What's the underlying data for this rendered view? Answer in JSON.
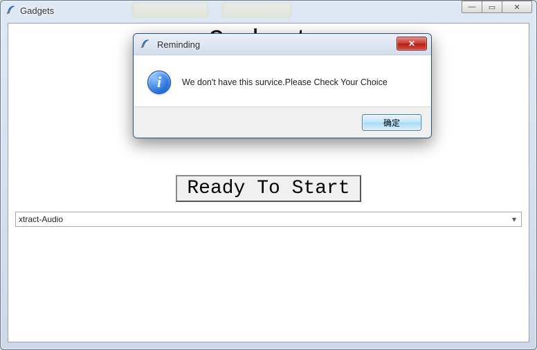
{
  "outer_window": {
    "title": "Gadgets"
  },
  "main": {
    "heading": "Gadgets",
    "start_button_label": "Ready To Start",
    "combo_value": "xtract-Audio"
  },
  "dialog": {
    "title": "Reminding",
    "message": "We don't have this survice.Please Check Your Choice",
    "ok_label": "确定"
  },
  "icons": {
    "minimize": "—",
    "maximize": "▭",
    "close": "✕",
    "dropdown": "▾",
    "info_letter": "i"
  }
}
